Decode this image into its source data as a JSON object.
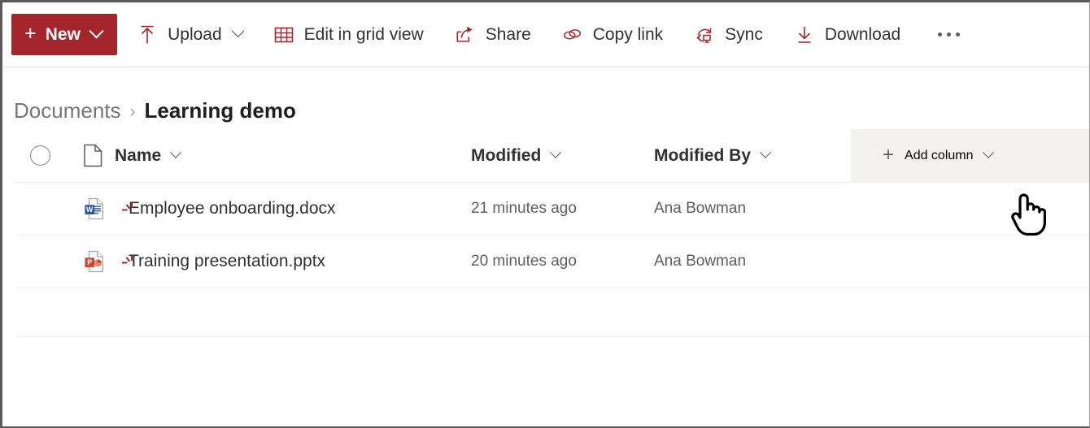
{
  "toolbar": {
    "new_button": {
      "label": "New",
      "icon": "plus-icon",
      "chevron": "chevron-down-icon",
      "color": "#a4262c"
    },
    "items": [
      {
        "label": "Upload",
        "icon": "upload-arrow-icon",
        "has_chevron": true
      },
      {
        "label": "Edit in grid view",
        "icon": "grid-table-icon",
        "has_chevron": false
      },
      {
        "label": "Share",
        "icon": "share-arrow-icon",
        "has_chevron": false
      },
      {
        "label": "Copy link",
        "icon": "link-chain-icon",
        "has_chevron": false
      },
      {
        "label": "Sync",
        "icon": "sync-refresh-icon",
        "has_chevron": false
      },
      {
        "label": "Download",
        "icon": "download-arrow-icon",
        "has_chevron": false
      }
    ],
    "overflow_label": "More options",
    "overflow_icon": "ellipsis-icon"
  },
  "breadcrumb": {
    "root": "Documents",
    "separator": "›",
    "current": "Learning demo"
  },
  "list": {
    "select_all_icon": "selection-circle-icon",
    "file_type_icon": "file-type-column-icon",
    "columns": [
      {
        "label": "Name",
        "has_chevron": true
      },
      {
        "label": "Modified",
        "has_chevron": true
      },
      {
        "label": "Modified By",
        "has_chevron": true
      }
    ],
    "add_column": {
      "label": "Add column",
      "plus": "+",
      "has_chevron": true,
      "background": "#f3f2f1"
    },
    "rows": [
      {
        "name": "Employee onboarding.docx",
        "file_icon": "word-document-icon",
        "new_badge": "new-item-sparkle-icon",
        "modified": "21 minutes ago",
        "modified_by": "Ana Bowman"
      },
      {
        "name": "Training presentation.pptx",
        "file_icon": "powerpoint-document-icon",
        "new_badge": "new-item-sparkle-icon",
        "modified": "20 minutes ago",
        "modified_by": "Ana Bowman"
      }
    ]
  },
  "cursor": {
    "icon": "pointing-hand-cursor"
  },
  "colors": {
    "accent_red": "#a4262c",
    "hover_gray": "#f3f2f1",
    "text_primary": "#323130",
    "text_secondary": "#605e5c",
    "word_blue": "#2b579a",
    "powerpoint_orange": "#d24726"
  }
}
